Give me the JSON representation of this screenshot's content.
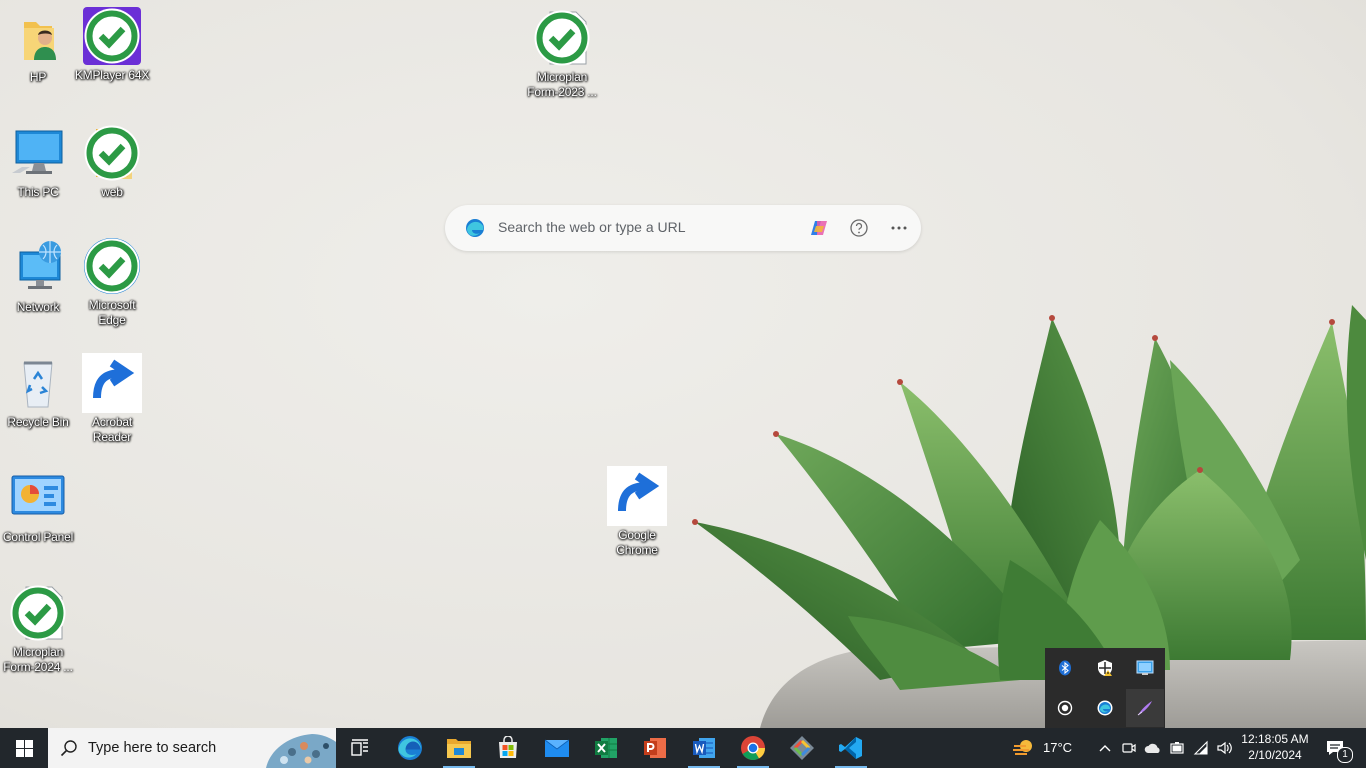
{
  "desktop": {
    "icons": {
      "hp": {
        "label": "HP"
      },
      "kmplayer": {
        "label": "KMPlayer 64X"
      },
      "microplan2023": {
        "label": "Microplan Form-2023 ..."
      },
      "thispc": {
        "label": "This PC"
      },
      "web": {
        "label": "web"
      },
      "network": {
        "label": "Network"
      },
      "edge": {
        "label": "Microsoft Edge"
      },
      "recycle": {
        "label": "Recycle Bin"
      },
      "acrobat": {
        "label": "Acrobat Reader"
      },
      "control": {
        "label": "Control Panel"
      },
      "chrome": {
        "label": "Google Chrome"
      },
      "microplan2024": {
        "label": "Microplan Form-2024 ..."
      }
    }
  },
  "edge_search": {
    "placeholder": "Search the web or type a URL",
    "icons": [
      "edge-logo-icon",
      "copilot-icon",
      "help-icon",
      "more-icon"
    ]
  },
  "tray_flyout": {
    "icons": [
      "bluetooth-icon",
      "defender-icon",
      "display-settings-icon",
      "record-icon",
      "edge-update-icon",
      "pen-icon"
    ]
  },
  "taskbar": {
    "search_placeholder": "Type here to search",
    "apps": [
      "task-view",
      "microsoft-edge",
      "file-explorer",
      "microsoft-store",
      "mail",
      "excel",
      "powerpoint",
      "word",
      "google-chrome",
      "git-gui",
      "visual-studio-code"
    ],
    "weather": "17°C",
    "time": "12:18:05 AM",
    "date": "2/10/2024",
    "notification_count": "1"
  },
  "colors": {
    "taskbar": "#22272c",
    "accent": "#76b9ed",
    "flyout": "#2b2b2b"
  }
}
